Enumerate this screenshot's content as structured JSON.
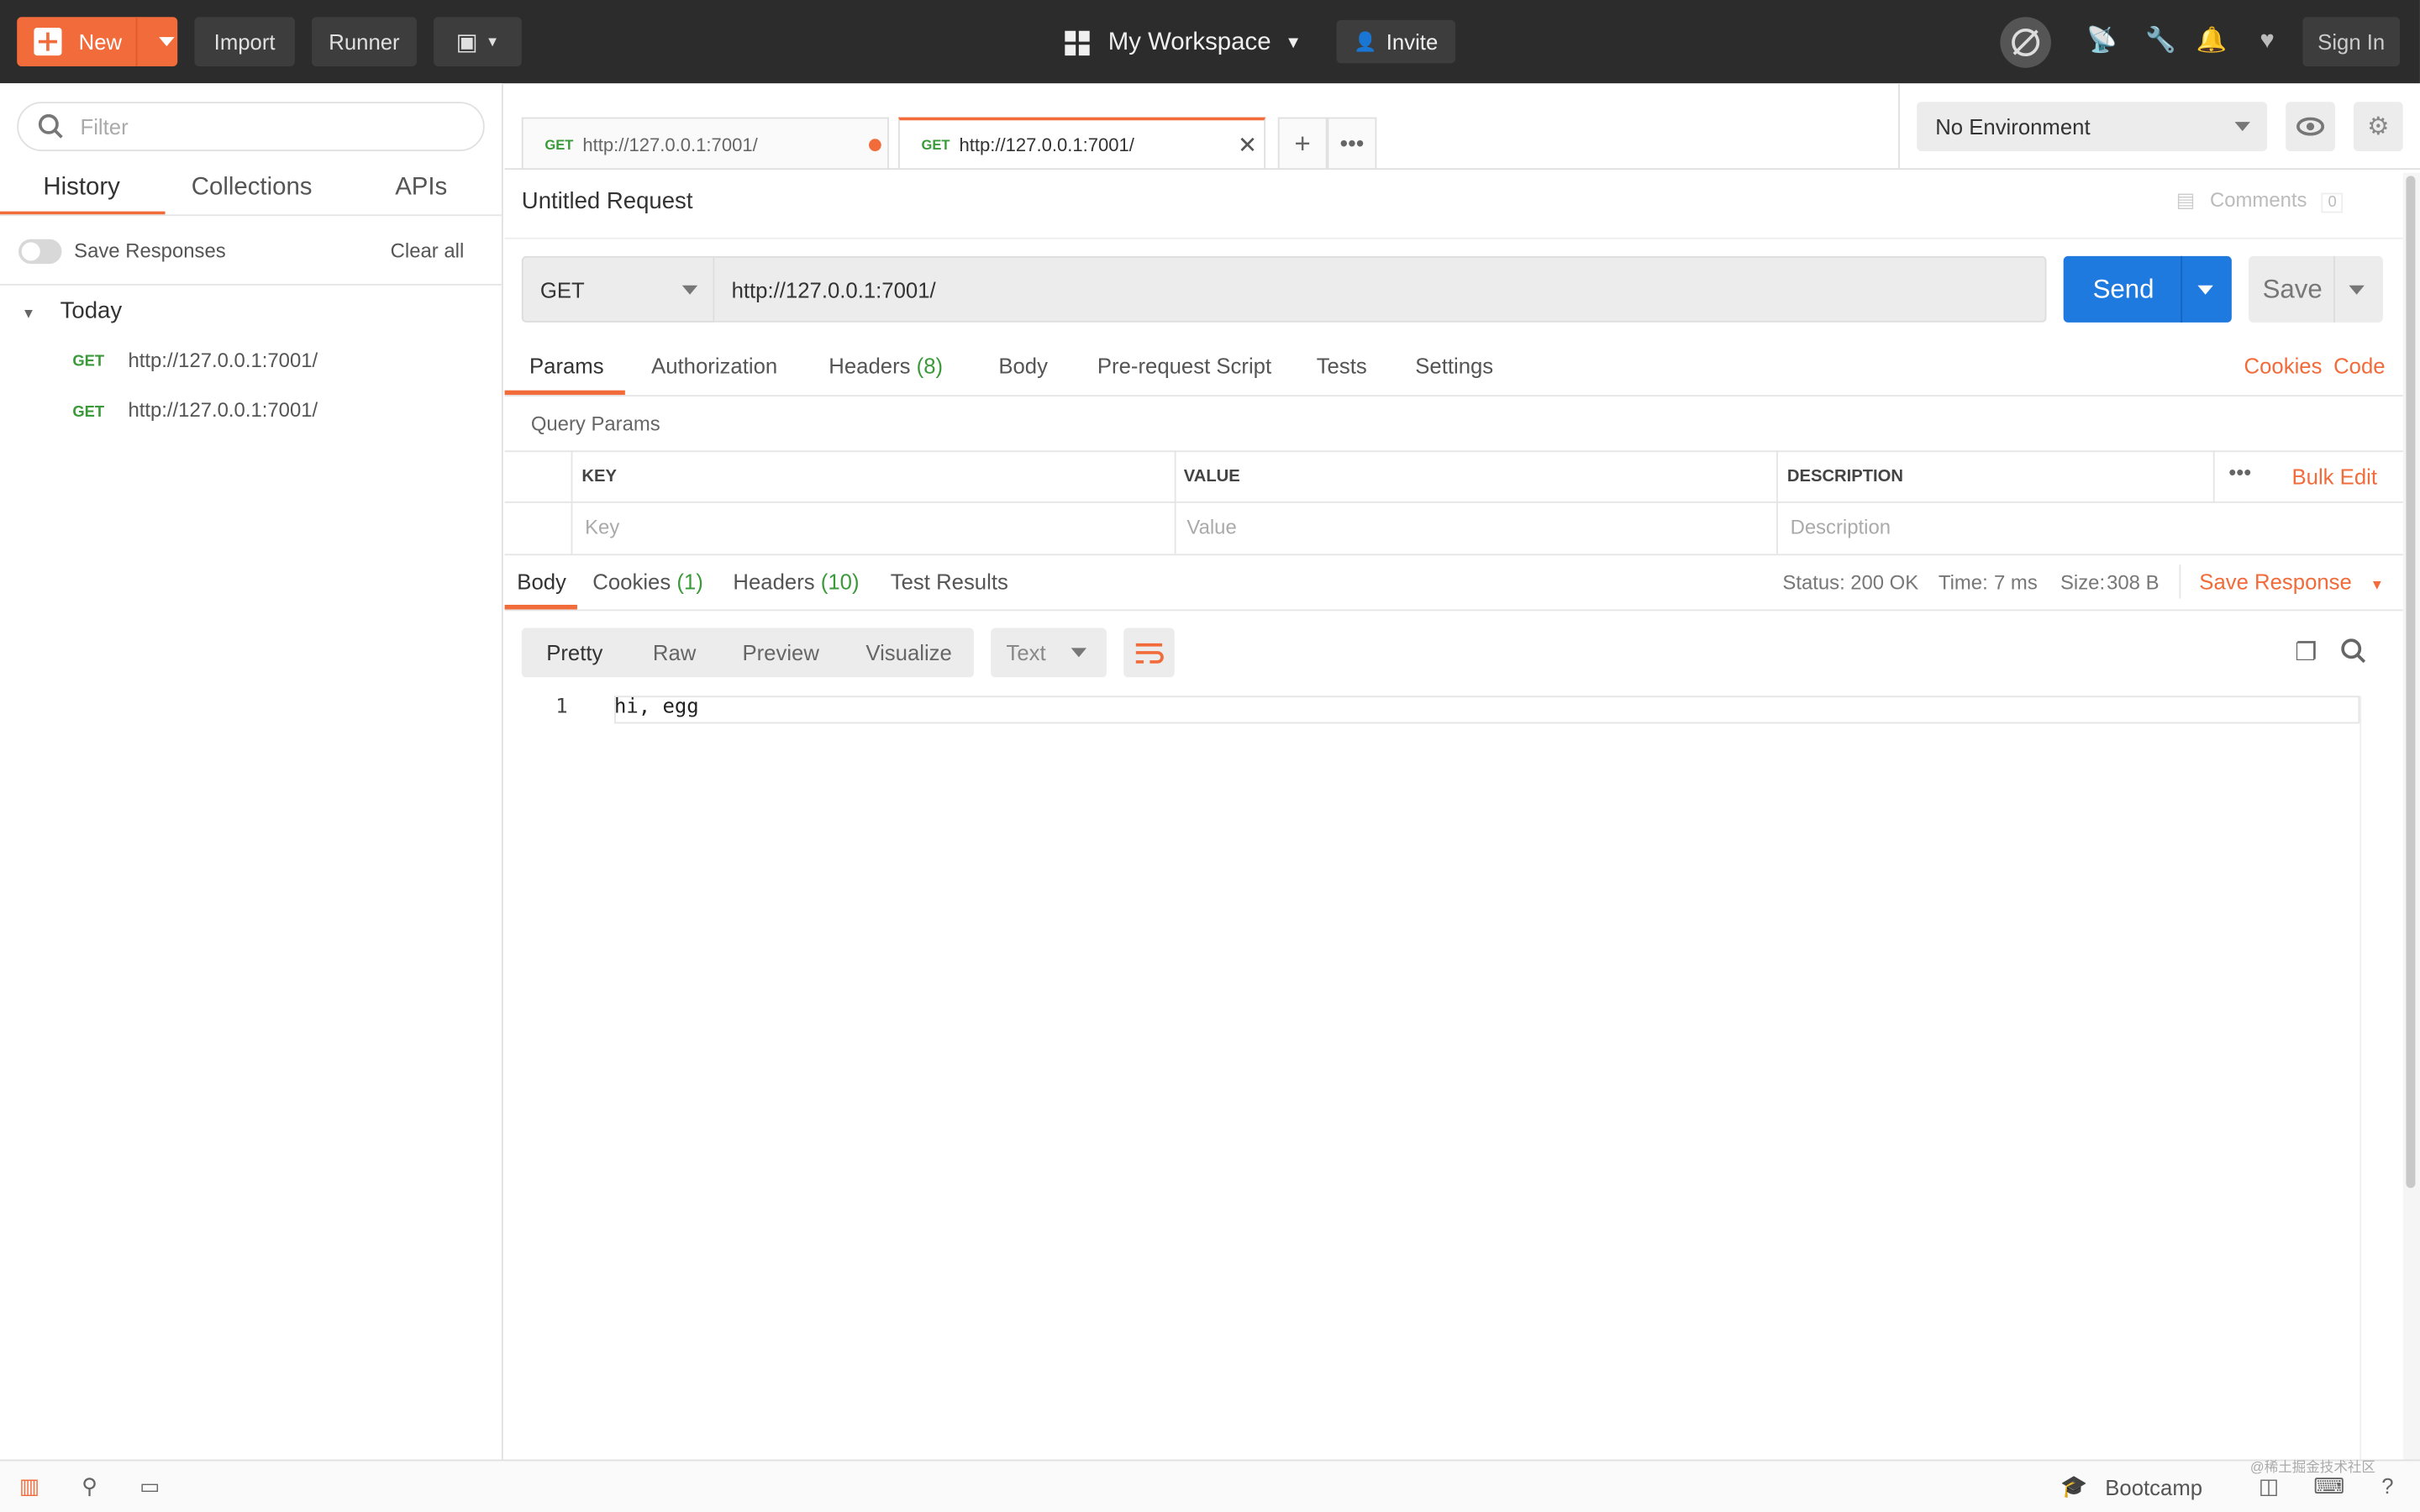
{
  "topbar": {
    "new_label": "New",
    "import_label": "Import",
    "runner_label": "Runner",
    "workspace_label": "My Workspace",
    "invite_label": "Invite",
    "signin_label": "Sign In"
  },
  "sidebar": {
    "filter_placeholder": "Filter",
    "tabs": [
      "History",
      "Collections",
      "APIs"
    ],
    "save_responses_label": "Save Responses",
    "clear_all_label": "Clear all",
    "group_label": "Today",
    "history": [
      {
        "method": "GET",
        "url": "http://127.0.0.1:7001/"
      },
      {
        "method": "GET",
        "url": "http://127.0.0.1:7001/"
      }
    ]
  },
  "tabs": [
    {
      "method": "GET",
      "url": "http://127.0.0.1:7001/",
      "unsaved": true
    },
    {
      "method": "GET",
      "url": "http://127.0.0.1:7001/",
      "active": true
    }
  ],
  "environment": {
    "selected": "No Environment"
  },
  "request": {
    "title": "Untitled Request",
    "comments_label": "Comments",
    "comments_count": "0",
    "method": "GET",
    "url": "http://127.0.0.1:7001/",
    "send_label": "Send",
    "save_label": "Save",
    "subtabs": {
      "params": "Params",
      "authorization": "Authorization",
      "headers": "Headers",
      "headers_count": "(8)",
      "body": "Body",
      "prerequest": "Pre-request Script",
      "tests": "Tests",
      "settings": "Settings"
    },
    "cookies_link": "Cookies",
    "code_link": "Code",
    "query_params_label": "Query Params",
    "table": {
      "headers": [
        "KEY",
        "VALUE",
        "DESCRIPTION"
      ],
      "placeholders": [
        "Key",
        "Value",
        "Description"
      ],
      "bulk_edit": "Bulk Edit"
    }
  },
  "response": {
    "tabs": {
      "body": "Body",
      "cookies": "Cookies",
      "cookies_count": "(1)",
      "headers": "Headers",
      "headers_count": "(10)",
      "test_results": "Test Results"
    },
    "status_label": "Status:",
    "status_value": "200 OK",
    "time_label": "Time:",
    "time_value": "7 ms",
    "size_label": "Size:",
    "size_value": "308 B",
    "save_response_label": "Save Response",
    "views": [
      "Pretty",
      "Raw",
      "Preview",
      "Visualize"
    ],
    "format": "Text",
    "line_number": "1",
    "body_text": "hi, egg"
  },
  "statusbar": {
    "bootcamp_label": "Bootcamp",
    "watermark": "@稀土掘金技术社区"
  },
  "colors": {
    "accent": "#f26b3a",
    "send_blue": "#1f7ae0",
    "status_green": "#3a9a3a",
    "topbar": "#2c2c2c"
  }
}
